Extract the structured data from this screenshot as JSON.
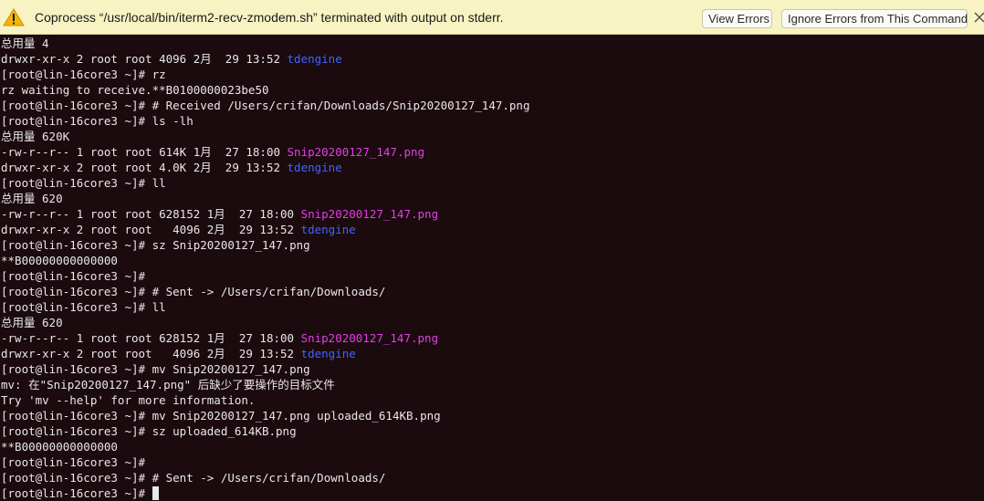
{
  "notification": {
    "message": "Coprocess “/usr/local/bin/iterm2-recv-zmodem.sh” terminated with output on stderr.",
    "view_errors_label": "View Errors",
    "ignore_errors_label": "Ignore Errors from This Command",
    "icon": "warning-icon",
    "close_icon": "close-icon"
  },
  "colors": {
    "background": "#1b0a0e",
    "text": "#e8e8e8",
    "directory": "#3f66ff",
    "image_file": "#e23fe6",
    "notification_bg": "#f7f3c2"
  },
  "terminal": {
    "lines": [
      {
        "text": "总用量 4"
      },
      {
        "text": "drwxr-xr-x 2 root root 4096 2月  29 13:52 ",
        "name": "tdengine",
        "color": "blue"
      },
      {
        "text": "[root@lin-16core3 ~]# rz"
      },
      {
        "text": "rz waiting to receive.**B0100000023be50"
      },
      {
        "text": "[root@lin-16core3 ~]# # Received /Users/crifan/Downloads/Snip20200127_147.png"
      },
      {
        "text": "[root@lin-16core3 ~]# ls -lh"
      },
      {
        "text": "总用量 620K"
      },
      {
        "text": "-rw-r--r-- 1 root root 614K 1月  27 18:00 ",
        "name": "Snip20200127_147.png",
        "color": "magenta"
      },
      {
        "text": "drwxr-xr-x 2 root root 4.0K 2月  29 13:52 ",
        "name": "tdengine",
        "color": "blue"
      },
      {
        "text": "[root@lin-16core3 ~]# ll"
      },
      {
        "text": "总用量 620"
      },
      {
        "text": "-rw-r--r-- 1 root root 628152 1月  27 18:00 ",
        "name": "Snip20200127_147.png",
        "color": "magenta"
      },
      {
        "text": "drwxr-xr-x 2 root root   4096 2月  29 13:52 ",
        "name": "tdengine",
        "color": "blue"
      },
      {
        "text": "[root@lin-16core3 ~]# sz Snip20200127_147.png"
      },
      {
        "text": "**B00000000000000"
      },
      {
        "text": "[root@lin-16core3 ~]#"
      },
      {
        "text": "[root@lin-16core3 ~]# # Sent -> /Users/crifan/Downloads/"
      },
      {
        "text": "[root@lin-16core3 ~]# ll"
      },
      {
        "text": "总用量 620"
      },
      {
        "text": "-rw-r--r-- 1 root root 628152 1月  27 18:00 ",
        "name": "Snip20200127_147.png",
        "color": "magenta"
      },
      {
        "text": "drwxr-xr-x 2 root root   4096 2月  29 13:52 ",
        "name": "tdengine",
        "color": "blue"
      },
      {
        "text": "[root@lin-16core3 ~]# mv Snip20200127_147.png"
      },
      {
        "text": "mv: 在\"Snip20200127_147.png\" 后缺少了要操作的目标文件"
      },
      {
        "text": "Try 'mv --help' for more information."
      },
      {
        "text": "[root@lin-16core3 ~]# mv Snip20200127_147.png uploaded_614KB.png"
      },
      {
        "text": "[root@lin-16core3 ~]# sz uploaded_614KB.png"
      },
      {
        "text": "**B00000000000000"
      },
      {
        "text": "[root@lin-16core3 ~]#"
      },
      {
        "text": "[root@lin-16core3 ~]# # Sent -> /Users/crifan/Downloads/"
      },
      {
        "text": "[root@lin-16core3 ~]# ",
        "cursor": true
      }
    ]
  }
}
